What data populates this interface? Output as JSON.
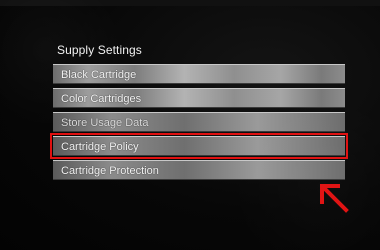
{
  "menu": {
    "title": "Supply Settings",
    "items": [
      {
        "label": "Black Cartridge"
      },
      {
        "label": "Color Cartridges"
      },
      {
        "label": "Store Usage Data"
      },
      {
        "label": "Cartridge Policy"
      },
      {
        "label": "Cartridge Protection"
      }
    ]
  },
  "annotation": {
    "highlight_color": "#e01010",
    "arrow_icon": "red-arrow-up-left-icon"
  }
}
